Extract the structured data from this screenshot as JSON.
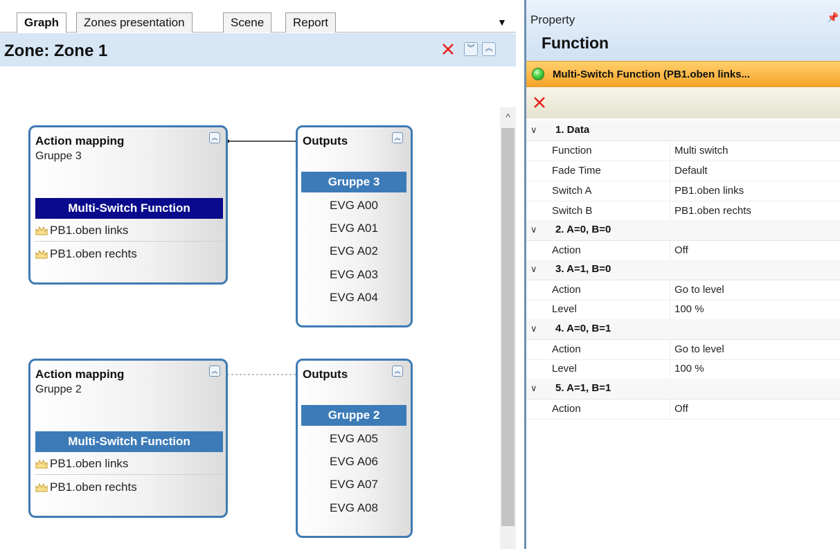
{
  "tabs": [
    {
      "label": "Graph",
      "active": true
    },
    {
      "label": "Zones presentation",
      "active": false
    },
    {
      "label": "Scene",
      "active": false
    },
    {
      "label": "Report",
      "active": false
    }
  ],
  "tab_menu_icon": "dropdown-arrow",
  "zone": {
    "title": "Zone: Zone 1"
  },
  "graph": {
    "mappings": [
      {
        "title": "Action mapping",
        "group": "Gruppe 3",
        "function": "Multi-Switch Function",
        "function_selected": true,
        "switches": [
          "PB1.oben links",
          "PB1.oben rechts"
        ]
      },
      {
        "title": "Action mapping",
        "group": "Gruppe 2",
        "function": "Multi-Switch Function",
        "function_selected": false,
        "switches": [
          "PB1.oben links",
          "PB1.oben rechts"
        ]
      }
    ],
    "outputs": [
      {
        "title": "Outputs",
        "group": "Gruppe 3",
        "items": [
          "EVG A00",
          "EVG A01",
          "EVG A02",
          "EVG A03",
          "EVG A04"
        ]
      },
      {
        "title": "Outputs",
        "group": "Gruppe 2",
        "items": [
          "EVG A05",
          "EVG A06",
          "EVG A07",
          "EVG A08"
        ]
      }
    ]
  },
  "property": {
    "panel_label": "Property",
    "title": "Function",
    "selected_function": "Multi-Switch Function (PB1.oben links...",
    "sections": [
      {
        "title": "1. Data",
        "rows": [
          {
            "key": "Function",
            "value": "Multi switch"
          },
          {
            "key": "Fade Time",
            "value": "Default"
          },
          {
            "key": "Switch A",
            "value": "PB1.oben links"
          },
          {
            "key": "Switch B",
            "value": "PB1.oben rechts"
          }
        ]
      },
      {
        "title": "2. A=0, B=0",
        "rows": [
          {
            "key": "Action",
            "value": "Off"
          }
        ]
      },
      {
        "title": "3. A=1, B=0",
        "rows": [
          {
            "key": "Action",
            "value": "Go to level"
          },
          {
            "key": "Level",
            "value": "100 %"
          }
        ]
      },
      {
        "title": "4. A=0, B=1",
        "rows": [
          {
            "key": "Action",
            "value": "Go to level"
          },
          {
            "key": "Level",
            "value": "100 %"
          }
        ]
      },
      {
        "title": "5. A=1, B=1",
        "rows": [
          {
            "key": "Action",
            "value": "Off"
          }
        ]
      }
    ]
  },
  "colors": {
    "accent": "#3c7bb8",
    "selected_dark": "#0a0a8c",
    "zone_bar": "#d7e6f5",
    "delete_red": "#e8201b",
    "function_strip": "#f6a42b"
  }
}
